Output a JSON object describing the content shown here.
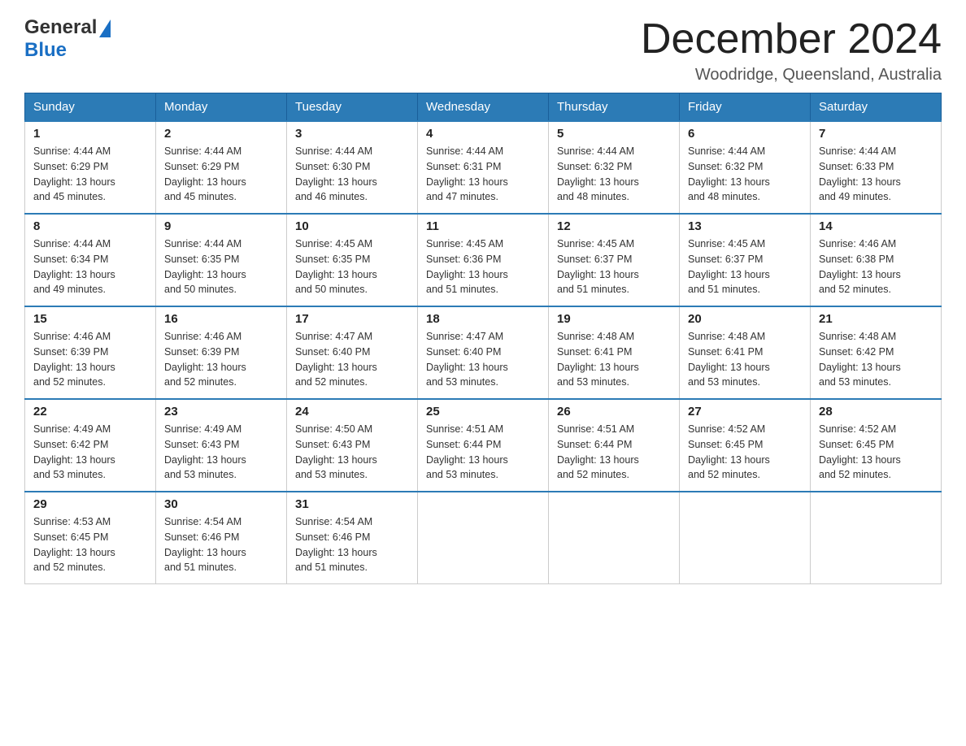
{
  "header": {
    "logo_general": "General",
    "logo_blue": "Blue",
    "month_title": "December 2024",
    "location": "Woodridge, Queensland, Australia"
  },
  "weekdays": [
    "Sunday",
    "Monday",
    "Tuesday",
    "Wednesday",
    "Thursday",
    "Friday",
    "Saturday"
  ],
  "weeks": [
    [
      {
        "day": "1",
        "sunrise": "4:44 AM",
        "sunset": "6:29 PM",
        "daylight": "13 hours and 45 minutes."
      },
      {
        "day": "2",
        "sunrise": "4:44 AM",
        "sunset": "6:29 PM",
        "daylight": "13 hours and 45 minutes."
      },
      {
        "day": "3",
        "sunrise": "4:44 AM",
        "sunset": "6:30 PM",
        "daylight": "13 hours and 46 minutes."
      },
      {
        "day": "4",
        "sunrise": "4:44 AM",
        "sunset": "6:31 PM",
        "daylight": "13 hours and 47 minutes."
      },
      {
        "day": "5",
        "sunrise": "4:44 AM",
        "sunset": "6:32 PM",
        "daylight": "13 hours and 48 minutes."
      },
      {
        "day": "6",
        "sunrise": "4:44 AM",
        "sunset": "6:32 PM",
        "daylight": "13 hours and 48 minutes."
      },
      {
        "day": "7",
        "sunrise": "4:44 AM",
        "sunset": "6:33 PM",
        "daylight": "13 hours and 49 minutes."
      }
    ],
    [
      {
        "day": "8",
        "sunrise": "4:44 AM",
        "sunset": "6:34 PM",
        "daylight": "13 hours and 49 minutes."
      },
      {
        "day": "9",
        "sunrise": "4:44 AM",
        "sunset": "6:35 PM",
        "daylight": "13 hours and 50 minutes."
      },
      {
        "day": "10",
        "sunrise": "4:45 AM",
        "sunset": "6:35 PM",
        "daylight": "13 hours and 50 minutes."
      },
      {
        "day": "11",
        "sunrise": "4:45 AM",
        "sunset": "6:36 PM",
        "daylight": "13 hours and 51 minutes."
      },
      {
        "day": "12",
        "sunrise": "4:45 AM",
        "sunset": "6:37 PM",
        "daylight": "13 hours and 51 minutes."
      },
      {
        "day": "13",
        "sunrise": "4:45 AM",
        "sunset": "6:37 PM",
        "daylight": "13 hours and 51 minutes."
      },
      {
        "day": "14",
        "sunrise": "4:46 AM",
        "sunset": "6:38 PM",
        "daylight": "13 hours and 52 minutes."
      }
    ],
    [
      {
        "day": "15",
        "sunrise": "4:46 AM",
        "sunset": "6:39 PM",
        "daylight": "13 hours and 52 minutes."
      },
      {
        "day": "16",
        "sunrise": "4:46 AM",
        "sunset": "6:39 PM",
        "daylight": "13 hours and 52 minutes."
      },
      {
        "day": "17",
        "sunrise": "4:47 AM",
        "sunset": "6:40 PM",
        "daylight": "13 hours and 52 minutes."
      },
      {
        "day": "18",
        "sunrise": "4:47 AM",
        "sunset": "6:40 PM",
        "daylight": "13 hours and 53 minutes."
      },
      {
        "day": "19",
        "sunrise": "4:48 AM",
        "sunset": "6:41 PM",
        "daylight": "13 hours and 53 minutes."
      },
      {
        "day": "20",
        "sunrise": "4:48 AM",
        "sunset": "6:41 PM",
        "daylight": "13 hours and 53 minutes."
      },
      {
        "day": "21",
        "sunrise": "4:48 AM",
        "sunset": "6:42 PM",
        "daylight": "13 hours and 53 minutes."
      }
    ],
    [
      {
        "day": "22",
        "sunrise": "4:49 AM",
        "sunset": "6:42 PM",
        "daylight": "13 hours and 53 minutes."
      },
      {
        "day": "23",
        "sunrise": "4:49 AM",
        "sunset": "6:43 PM",
        "daylight": "13 hours and 53 minutes."
      },
      {
        "day": "24",
        "sunrise": "4:50 AM",
        "sunset": "6:43 PM",
        "daylight": "13 hours and 53 minutes."
      },
      {
        "day": "25",
        "sunrise": "4:51 AM",
        "sunset": "6:44 PM",
        "daylight": "13 hours and 53 minutes."
      },
      {
        "day": "26",
        "sunrise": "4:51 AM",
        "sunset": "6:44 PM",
        "daylight": "13 hours and 52 minutes."
      },
      {
        "day": "27",
        "sunrise": "4:52 AM",
        "sunset": "6:45 PM",
        "daylight": "13 hours and 52 minutes."
      },
      {
        "day": "28",
        "sunrise": "4:52 AM",
        "sunset": "6:45 PM",
        "daylight": "13 hours and 52 minutes."
      }
    ],
    [
      {
        "day": "29",
        "sunrise": "4:53 AM",
        "sunset": "6:45 PM",
        "daylight": "13 hours and 52 minutes."
      },
      {
        "day": "30",
        "sunrise": "4:54 AM",
        "sunset": "6:46 PM",
        "daylight": "13 hours and 51 minutes."
      },
      {
        "day": "31",
        "sunrise": "4:54 AM",
        "sunset": "6:46 PM",
        "daylight": "13 hours and 51 minutes."
      },
      null,
      null,
      null,
      null
    ]
  ],
  "labels": {
    "sunrise": "Sunrise:",
    "sunset": "Sunset:",
    "daylight": "Daylight:"
  }
}
